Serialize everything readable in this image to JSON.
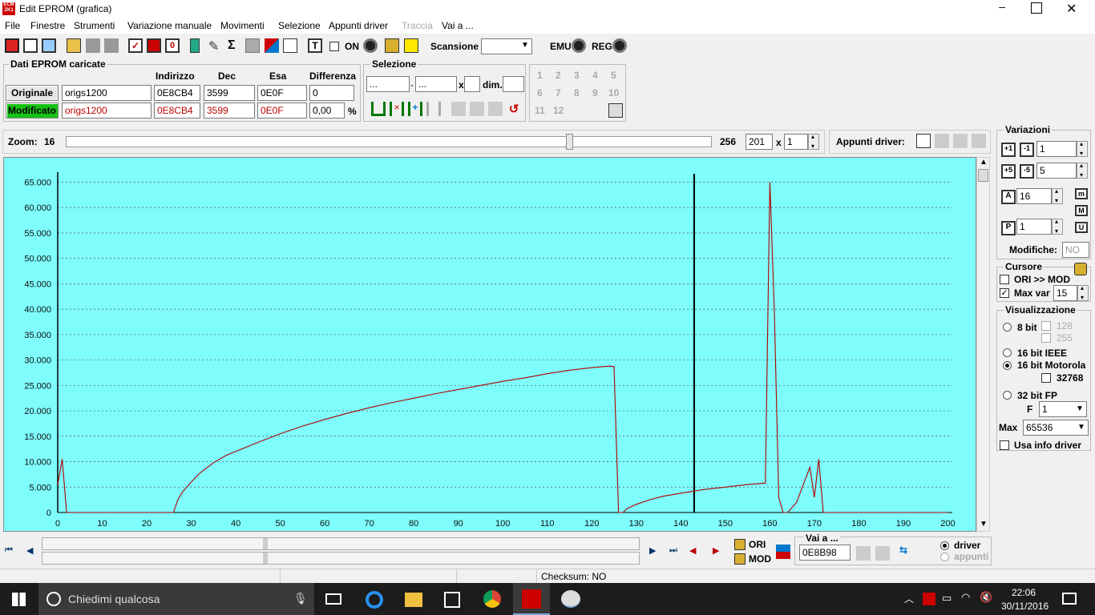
{
  "window": {
    "title": "Edit EPROM (grafica)",
    "app_icon_text": "ECM\nZK1"
  },
  "menu": [
    "File",
    "Finestre",
    "Strumenti",
    "Variazione manuale",
    "Movimenti",
    "Selezione",
    "Appunti driver",
    "Traccia",
    "Vai a ..."
  ],
  "toolbar": {
    "on_label": "ON",
    "scan_label": "Scansione",
    "emu_label": "EMU",
    "reg_label": "REG"
  },
  "eprom": {
    "title": "Dati EPROM caricate",
    "headers": [
      "Indirizzo",
      "Dec",
      "Esa",
      "Differenza"
    ],
    "orig_label": "Originale",
    "mod_label": "Modificato",
    "orig": {
      "name": "origs1200",
      "addr": "0E8CB4",
      "dec": "3599",
      "esa": "0E0F",
      "diff": "0"
    },
    "mod": {
      "name": "origs1200",
      "addr": "0E8CB4",
      "dec": "3599",
      "esa": "0E0F",
      "diff": "0,00",
      "unit": "%"
    }
  },
  "selection": {
    "title": "Selezione",
    "from": "...",
    "to": "...",
    "x_label": "x",
    "dim_label": "dim."
  },
  "numpad": [
    "1",
    "2",
    "3",
    "4",
    "5",
    "6",
    "7",
    "8",
    "9",
    "10",
    "11",
    "12"
  ],
  "zoom": {
    "label": "Zoom:",
    "min": "16",
    "max": "256",
    "value": 0.78,
    "field": "201",
    "x_label": "x",
    "mult": "1"
  },
  "appunti": {
    "label": "Appunti driver:"
  },
  "variazioni": {
    "title": "Variazioni",
    "v1": "1",
    "v2": "5",
    "v3": "16",
    "v4": "1",
    "modifiche_label": "Modifiche:",
    "modifiche_value": "NO"
  },
  "cursore": {
    "title": "Cursore",
    "ori_mod": "ORI >> MOD",
    "maxvar_label": "Max var",
    "maxvar_value": "15"
  },
  "visual": {
    "title": "Visualizzazione",
    "bit8": "8 bit",
    "v128": "128",
    "v255": "255",
    "bit16ieee": "16 bit IEEE",
    "bit16mot": "16 bit Motorola",
    "v32768": "32768",
    "bit32": "32 bit FP",
    "f_label": "F",
    "f_value": "1",
    "max_label": "Max",
    "max_value": "65536",
    "usa_info": "Usa info driver"
  },
  "bottom": {
    "ori": "ORI",
    "mod": "MOD",
    "vai_label": "Vai a ...",
    "vai_value": "0E8B98",
    "driver": "driver",
    "appunti": "appunti",
    "checksum": "Checksum: NO"
  },
  "taskbar": {
    "search": "Chiedimi qualcosa",
    "time": "22:06",
    "date": "30/11/2016"
  },
  "colors": {
    "plot_bg": "#7ffcfc",
    "line": "#b00000",
    "modificato_bg": "#16c216"
  },
  "chart_data": {
    "type": "line",
    "title": "",
    "xlabel": "",
    "ylabel": "",
    "xlim": [
      0,
      201
    ],
    "ylim": [
      0,
      65535
    ],
    "x_ticks": [
      "0",
      "10",
      "20",
      "30",
      "40",
      "50",
      "60",
      "70",
      "80",
      "90",
      "100",
      "110",
      "120",
      "130",
      "140",
      "150",
      "160",
      "170",
      "180",
      "190",
      "200"
    ],
    "y_ticks": [
      "0",
      "5.000",
      "10.000",
      "15.000",
      "20.000",
      "25.000",
      "30.000",
      "35.000",
      "40.000",
      "45.000",
      "50.000",
      "55.000",
      "60.000",
      "65.000"
    ],
    "cursor_x": 143,
    "series": [
      {
        "x": [
          0,
          1,
          2,
          26,
          27,
          28,
          29,
          30,
          32,
          35,
          38,
          40,
          45,
          50,
          55,
          60,
          65,
          70,
          75,
          80,
          85,
          90,
          95,
          100,
          105,
          110,
          115,
          120,
          124,
          125,
          126,
          127,
          128,
          130,
          133,
          136,
          140,
          145,
          150,
          155,
          159,
          160,
          161,
          162,
          163,
          164,
          166,
          169,
          170,
          171,
          172,
          173,
          174,
          200
        ],
        "y": [
          5500,
          10500,
          0,
          0,
          2500,
          4000,
          5000,
          6000,
          7800,
          9800,
          11300,
          12000,
          13800,
          15500,
          17000,
          18300,
          19500,
          20600,
          21600,
          22500,
          23400,
          24200,
          25000,
          25800,
          26500,
          27300,
          28000,
          28500,
          28800,
          28700,
          0,
          0,
          800,
          1600,
          2500,
          3200,
          3800,
          4500,
          5000,
          5500,
          5800,
          65000,
          40000,
          3000,
          0,
          0,
          2000,
          8900,
          3000,
          10500,
          0,
          0,
          0,
          0
        ]
      }
    ]
  }
}
